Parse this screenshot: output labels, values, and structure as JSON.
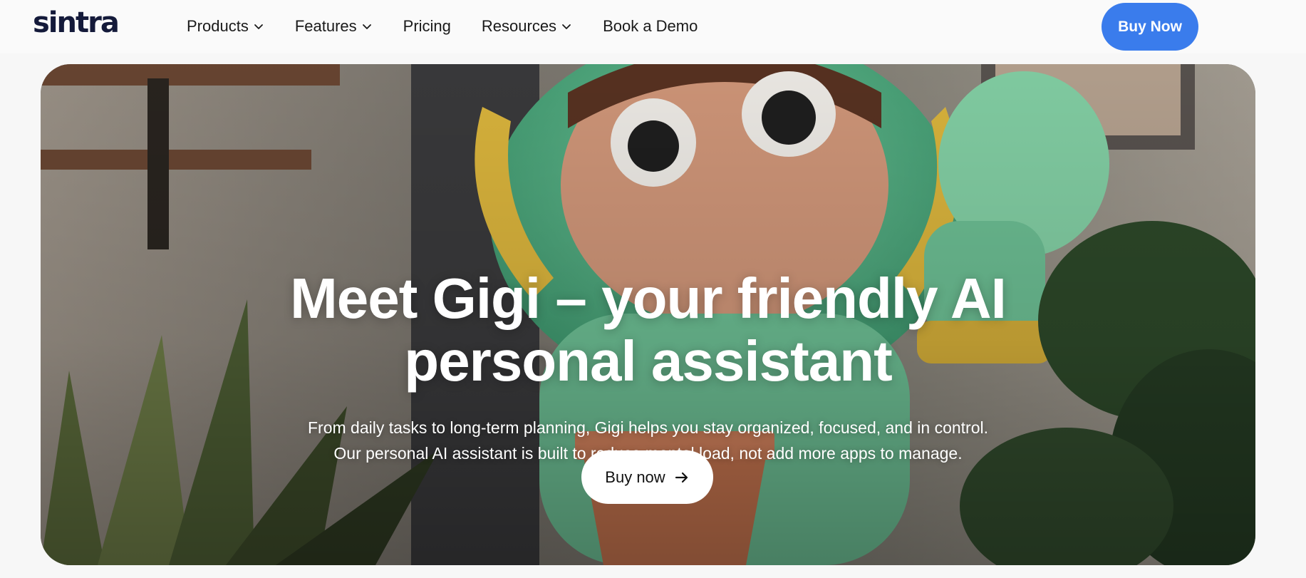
{
  "nav": {
    "logo": "sintra",
    "items": [
      {
        "label": "Products",
        "has_dropdown": true
      },
      {
        "label": "Features",
        "has_dropdown": true
      },
      {
        "label": "Pricing",
        "has_dropdown": false
      },
      {
        "label": "Resources",
        "has_dropdown": true
      },
      {
        "label": "Book a Demo",
        "has_dropdown": false
      }
    ],
    "cta_label": "Buy Now"
  },
  "hero": {
    "title_line1": "Meet Gigi – your friendly AI",
    "title_line2": "personal assistant",
    "subtitle": "From daily tasks to long-term planning, Gigi helps you stay organized, focused, and in control. Our personal AI assistant is built to reduce mental load, not add more apps to manage.",
    "cta_label": "Buy now",
    "cta_icon": "arrow-right-icon"
  },
  "colors": {
    "accent": "#3a7cec",
    "logo": "#141a3a",
    "background": "#f7f7f7"
  }
}
